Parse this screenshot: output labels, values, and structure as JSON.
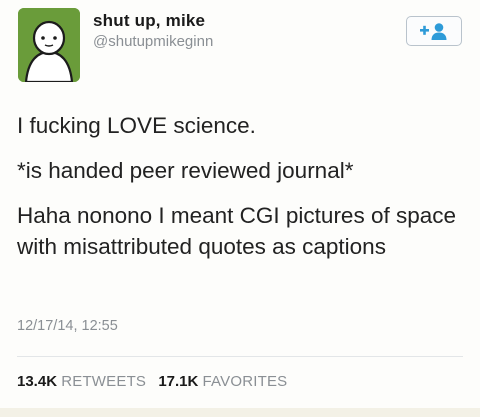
{
  "user": {
    "display_name": "shut up, mike",
    "handle": "@shutupmikeginn",
    "avatar_icon": "simple-figure-avatar",
    "avatar_color": "#6a9c3a"
  },
  "follow_button": {
    "icon": "add-user-icon",
    "color": "#2e9bd8"
  },
  "tweet": {
    "lines": [
      "I fucking LOVE science.",
      "*is handed peer reviewed journal*",
      "Haha nonono I meant CGI pictures of space with misattributed quotes as captions"
    ],
    "timestamp": "12/17/14, 12:55"
  },
  "stats": {
    "retweets_count": "13.4K",
    "retweets_label": "RETWEETS",
    "favorites_count": "17.1K",
    "favorites_label": "FAVORITES"
  }
}
